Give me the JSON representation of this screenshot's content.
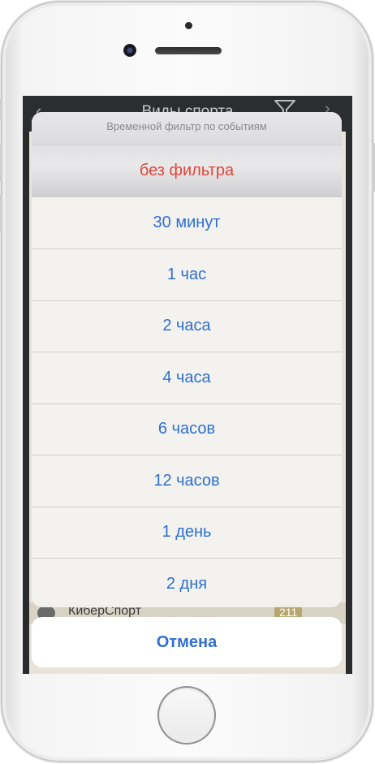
{
  "app": {
    "header_title": "Виды спорта",
    "back_glyph": "‹",
    "more_glyph": "›",
    "rows": [
      {
        "label": "КиберСпорт",
        "count": "211"
      }
    ]
  },
  "action_sheet": {
    "title": "Временной фильтр по событиям",
    "options": [
      {
        "label": "без фильтра",
        "style": "destructive"
      },
      {
        "label": "30 минут"
      },
      {
        "label": "1 час"
      },
      {
        "label": "2 часа"
      },
      {
        "label": "4 часа"
      },
      {
        "label": "6 часов"
      },
      {
        "label": "12 часов"
      },
      {
        "label": "1 день"
      },
      {
        "label": "2 дня"
      }
    ],
    "cancel_label": "Отмена"
  },
  "colors": {
    "accent_blue": "#2f6fd0",
    "destructive_red": "#e0463a",
    "sheet_background": "#f3f2ee",
    "title_gray": "#8a8a8f"
  },
  "icons": {
    "filter": "funnel-icon",
    "camera": "camera-icon",
    "gamepad": "gamepad-icon"
  }
}
